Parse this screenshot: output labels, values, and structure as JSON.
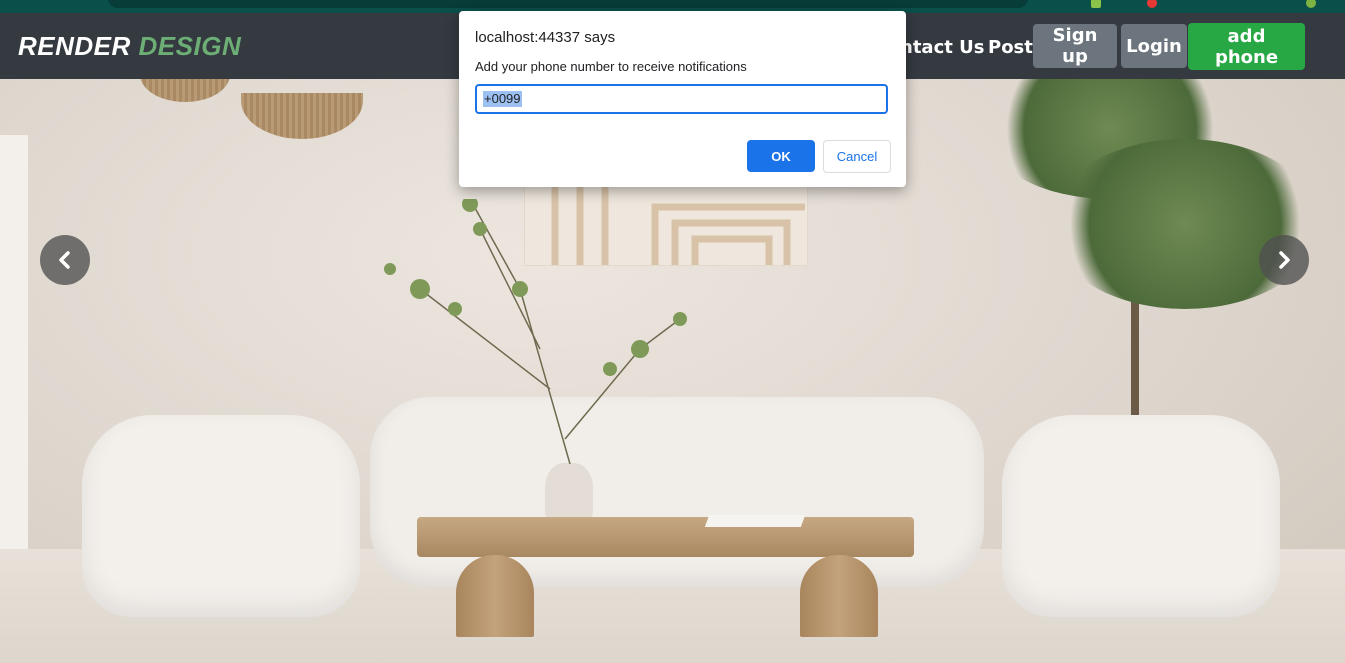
{
  "navbar": {
    "brand_part1": "RENDER",
    "brand_part2": "DESIGN",
    "links": [
      "ntact Us",
      "Post"
    ],
    "buttons": {
      "signup": "Sign up",
      "login": "Login",
      "add_phone": "add phone"
    }
  },
  "dialog": {
    "title": "localhost:44337 says",
    "message": "Add your phone number to receive notifications",
    "input_value": "+0099",
    "ok_label": "OK",
    "cancel_label": "Cancel"
  },
  "carousel": {
    "prev_icon": "chevron-left-icon",
    "next_icon": "chevron-right-icon"
  },
  "colors": {
    "navbar_bg": "#343a40",
    "brand_accent": "#6cae75",
    "button_gray": "#6c757d",
    "button_green": "#28a745",
    "dialog_primary": "#1a73e8"
  }
}
